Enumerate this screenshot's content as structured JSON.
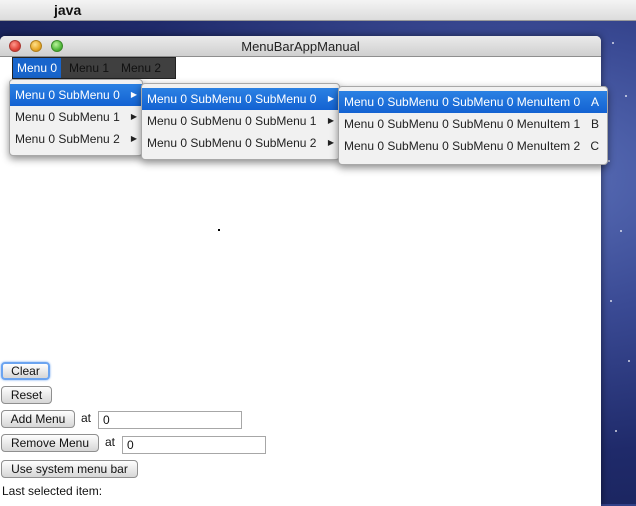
{
  "mac_menubar": {
    "app_name": "java",
    "apple_icon": "apple-logo-icon"
  },
  "window": {
    "title": "MenuBarAppManual"
  },
  "menubar": {
    "menus": [
      "Menu 0",
      "Menu 1",
      "Menu 2"
    ],
    "selected_menu": "Menu 0"
  },
  "level1": {
    "items": [
      "Menu 0 SubMenu 0",
      "Menu 0 SubMenu 1",
      "Menu 0 SubMenu 2"
    ],
    "selected": "Menu 0 SubMenu 0"
  },
  "level2": {
    "items": [
      "Menu 0 SubMenu 0 SubMenu 0",
      "Menu 0 SubMenu 0 SubMenu 1",
      "Menu 0 SubMenu 0 SubMenu 2"
    ],
    "selected": "Menu 0 SubMenu 0 SubMenu 0"
  },
  "level3": {
    "items": [
      {
        "label": "Menu 0 SubMenu 0 SubMenu 0 MenuItem 0",
        "accel": "A"
      },
      {
        "label": "Menu 0 SubMenu 0 SubMenu 0 MenuItem 1",
        "accel": "B"
      },
      {
        "label": "Menu 0 SubMenu 0 SubMenu 0 MenuItem 2",
        "accel": "C"
      }
    ],
    "selected": "Menu 0 SubMenu 0 SubMenu 0 MenuItem 0"
  },
  "controls": {
    "clear_label": "Clear",
    "reset_label": "Reset",
    "add_menu_label": "Add Menu",
    "at_label": "at",
    "add_menu_index": "0",
    "remove_menu_label": "Remove Menu",
    "remove_menu_index": "0",
    "use_system_menu_bar_label": "Use system menu bar",
    "last_selected_label": "Last selected item:"
  }
}
